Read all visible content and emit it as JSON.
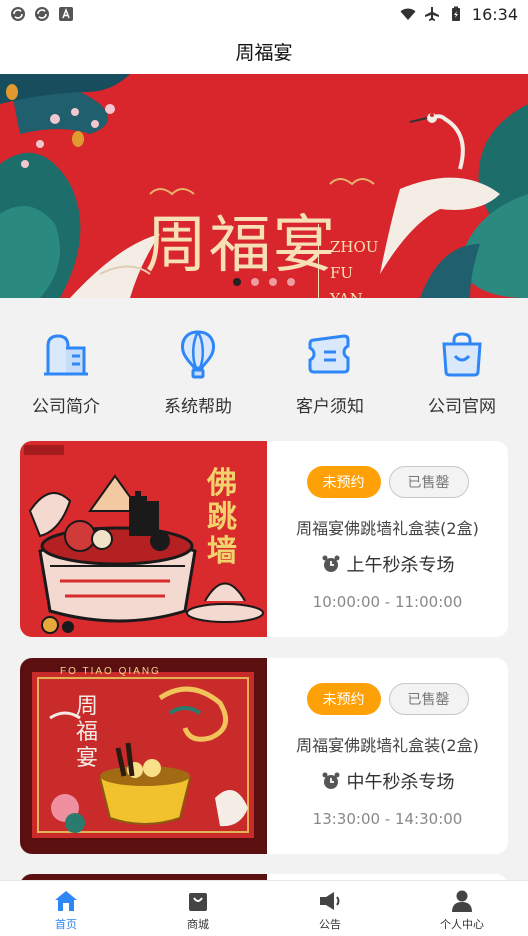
{
  "status_bar": {
    "time": "16:34",
    "left_icons": [
      "sync-icon",
      "sync-icon",
      "a-icon"
    ],
    "right_icons": [
      "wifi-icon",
      "airplane-icon",
      "battery-icon"
    ]
  },
  "header": {
    "title": "周福宴"
  },
  "banner": {
    "logo_cn": "周福宴",
    "logo_en": [
      "ZHOU",
      "FU",
      "YAN"
    ],
    "dots_total": 4,
    "active_dot": 0
  },
  "quick_menu": [
    {
      "label": "公司简介",
      "icon": "building-icon"
    },
    {
      "label": "系统帮助",
      "icon": "balloon-icon"
    },
    {
      "label": "客户须知",
      "icon": "ticket-icon"
    },
    {
      "label": "公司官网",
      "icon": "shopping-bag-icon"
    }
  ],
  "products": [
    {
      "image_text": "佛跳墙",
      "status_button": "未预约",
      "sold_out_button": "已售罄",
      "name": "周福宴佛跳墙礼盒装(2盒)",
      "session": "上午秒杀专场",
      "time_range": "10:00:00 - 11:00:00"
    },
    {
      "image_text": "周福宴",
      "image_banner": "FO TIAO QIANG",
      "status_button": "未预约",
      "sold_out_button": "已售罄",
      "name": "周福宴佛跳墙礼盒装(2盒)",
      "session": "中午秒杀专场",
      "time_range": "13:30:00 - 14:30:00"
    }
  ],
  "bottom_nav": [
    {
      "label": "首页",
      "icon": "home-icon",
      "active": true
    },
    {
      "label": "商城",
      "icon": "shop-bag-icon",
      "active": false
    },
    {
      "label": "公告",
      "icon": "megaphone-icon",
      "active": false
    },
    {
      "label": "个人中心",
      "icon": "user-icon",
      "active": false
    }
  ],
  "colors": {
    "accent_blue": "#2f86f6",
    "primary_orange": "#fea008",
    "banner_red": "#d8262c",
    "gold": "#f7dfb6"
  }
}
